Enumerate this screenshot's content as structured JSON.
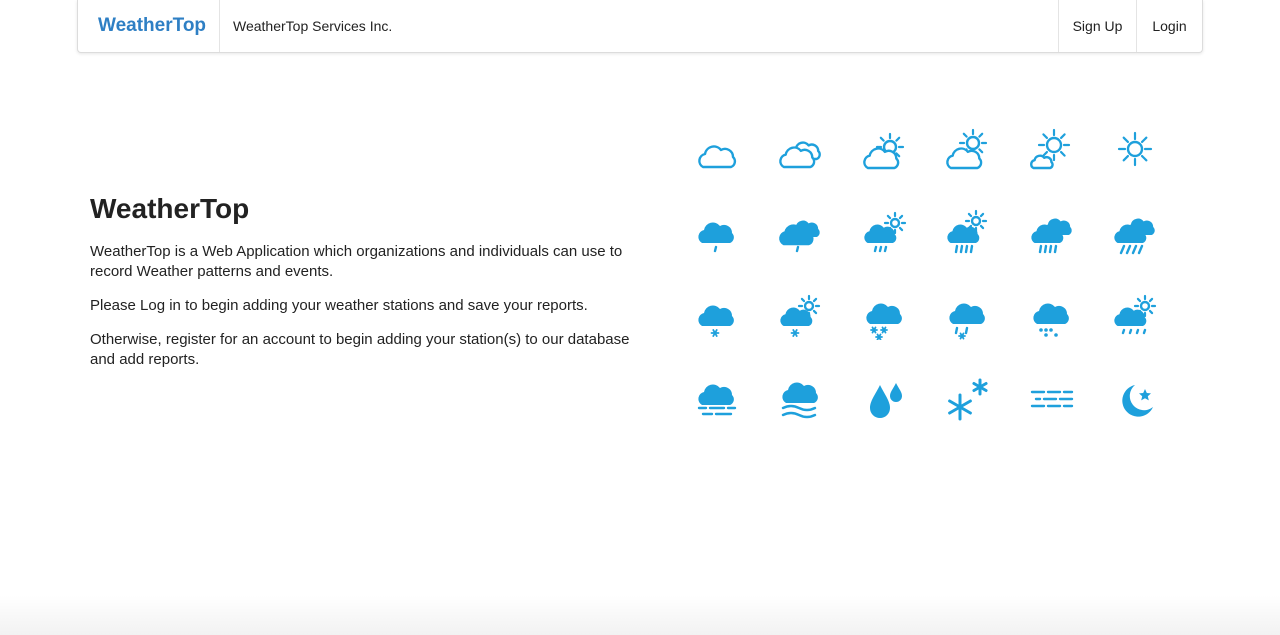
{
  "nav": {
    "brand": "WeatherTop",
    "company": "WeatherTop Services Inc.",
    "signup_label": "Sign Up",
    "login_label": "Login"
  },
  "intro": {
    "title": "WeatherTop",
    "paragraphs": [
      "WeatherTop is a Web Application which organizations and individuals can use to record Weather patterns and events.",
      "Please Log in to begin adding your weather stations and save your reports.",
      "Otherwise, register for an account to begin adding your station(s) to our database and add reports."
    ]
  },
  "weather_icons": {
    "color": "#1ea0dc",
    "rows": [
      [
        "cloud-outline-icon",
        "cloud-double-outline-icon",
        "cloud-sun-partial-icon",
        "cloud-sun-icon",
        "sun-cloud-small-icon",
        "sun-icon"
      ],
      [
        "cloud-rain-icon",
        "cloud-double-rain-icon",
        "cloud-sun-rain-icon",
        "cloud-sun-heavy-rain-icon",
        "cloud-double-heavy-rain-icon",
        "cloud-double-slant-rain-icon"
      ],
      [
        "cloud-snow-icon",
        "cloud-sun-snow-icon",
        "cloud-heavy-snow-icon",
        "cloud-sleet-icon",
        "cloud-hail-icon",
        "cloud-sun-drizzle-icon"
      ],
      [
        "cloud-fog-icon",
        "cloud-wind-icon",
        "raindrops-icon",
        "snowflakes-icon",
        "haze-icon",
        "moon-star-icon"
      ]
    ]
  }
}
